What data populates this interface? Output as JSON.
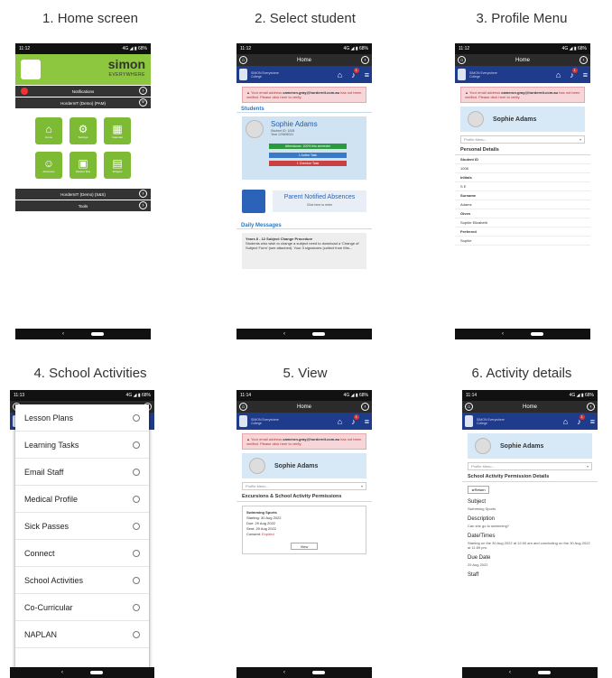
{
  "panels": [
    {
      "title": "1. Home screen"
    },
    {
      "title": "2. Select student"
    },
    {
      "title": "3. Profile Menu"
    },
    {
      "title": "4. School Activities"
    },
    {
      "title": "5. View"
    },
    {
      "title": "6. Activity details"
    }
  ],
  "status": {
    "time1": "11:12",
    "time2": "11:13",
    "time3": "11:14",
    "right": "4G ◢ ▮ 68%"
  },
  "home": {
    "brand": "simon",
    "brand_sub": "EVERYWHERE",
    "rows": [
      "Notifications",
      "HordernIT (Demo) (PAM)",
      "HordernIT (Demo) (S&S)",
      "Tools"
    ],
    "tiles": [
      "Home",
      "Settings",
      "Calendar",
      "Absences",
      "Student Bus",
      "Widgets"
    ]
  },
  "appbar_title": "Home",
  "school_name": "SIMON Everywhere College",
  "notify_count": "1",
  "warn": {
    "line1": "Your email address",
    "email": "cameron.gray@hordernit.com.au",
    "line2": "has not been verified. Please click here to verify."
  },
  "students": {
    "section": "Students",
    "name": "Sophie Adams",
    "meta1": "Student ID: 1008",
    "meta2": "Year 12/N08041",
    "attendance": "Attendance: 100% this semester",
    "active": "1 Active Task",
    "overdue": "1 Overdue Task",
    "absence_title": "Parent Notified Absences",
    "absence_sub": "Click here to enter",
    "daily": "Daily Messages",
    "msg_title": "Years 8 - 12 Subject Change Procedure",
    "msg_body": "Students who wish to change a subject need to download a 'Change of Subject Form' (see attached). Your 3 signatures (collect from Mrs..."
  },
  "profile": {
    "menu_placeholder": "Profile Menu...",
    "section": "Personal Details",
    "fields": [
      {
        "label": "Student ID",
        "value": "1008"
      },
      {
        "label": "Initials",
        "value": "S E"
      },
      {
        "label": "Surname",
        "value": "Adams"
      },
      {
        "label": "Given",
        "value": "Sophie Elizabeth"
      },
      {
        "label": "Preferred",
        "value": "Sophie"
      }
    ]
  },
  "menu_items": [
    "Lesson Plans",
    "Learning Tasks",
    "Email Staff",
    "Medical Profile",
    "Sick Passes",
    "Connect",
    "School Activities",
    "Co-Curricular",
    "NAPLAN"
  ],
  "view": {
    "section": "Excursions & School Activity Permissions",
    "activity": "Swimming Sports",
    "starting": "Starting: 30 Aug 2022",
    "due": "Due: 29 Aug 2022",
    "sent": "Sent: 29 Aug 2022",
    "consent_label": "Consent:",
    "consent": "Expired",
    "button": "View"
  },
  "details": {
    "section": "School Activity Permission Details",
    "return": "◂ Return",
    "subject_h": "Subject",
    "subject": "Swimming Sports",
    "desc_h": "Description",
    "desc": "Can she go to swimming?",
    "dates_h": "Date/Times",
    "dates": "Starting on the 30 Aug 2022 at 12:00 am and concluding on the 30 Aug 2022 at 11:59 pm.",
    "due_h": "Due Date",
    "due": "29 Aug 2022",
    "staff_h": "Staff"
  }
}
